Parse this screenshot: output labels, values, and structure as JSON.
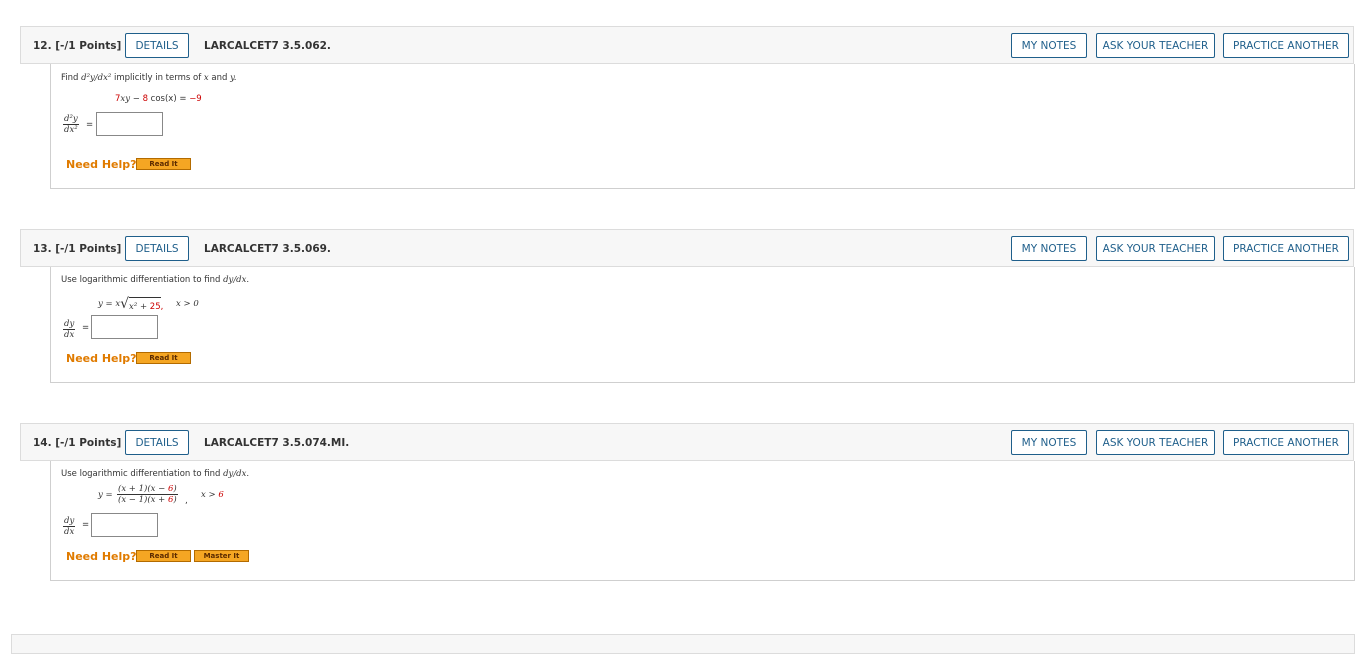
{
  "buttons": {
    "details": "DETAILS",
    "my_notes": "MY NOTES",
    "ask_teacher": "ASK YOUR TEACHER",
    "practice_another": "PRACTICE ANOTHER"
  },
  "need_help": "Need Help?",
  "help_buttons": {
    "read_it": "Read It",
    "master_it": "Master It"
  },
  "questions": [
    {
      "number": "12.  [-/1 Points]",
      "code": "LARCALCET7 3.5.062.",
      "prompt_pre": "Find ",
      "prompt_math": "d²y/dx²",
      "prompt_post": " implicitly in terms of ",
      "prompt_x": "x",
      "prompt_and": " and ",
      "prompt_y": "y.",
      "equation": {
        "c1": "7",
        "t1": "xy",
        "minus": " − ",
        "c2": "8",
        "t2": " cos(x) = ",
        "rhs": "−9"
      },
      "answer_lhs_top": "d²y",
      "answer_lhs_bot": "dx²",
      "answer_value": ""
    },
    {
      "number": "13.  [-/1 Points]",
      "code": "LARCALCET7 3.5.069.",
      "prompt_pre": "Use logarithmic differentiation to find ",
      "prompt_math": "dy/dx.",
      "equation": {
        "lhs": "y = x",
        "rad_a": "x² + ",
        "rad_b": "25",
        "comma": ",",
        "cond": "x > 0"
      },
      "answer_lhs_top": "dy",
      "answer_lhs_bot": "dx",
      "answer_value": ""
    },
    {
      "number": "14.  [-/1 Points]",
      "code": "LARCALCET7 3.5.074.MI.",
      "prompt_pre": "Use logarithmic differentiation to find ",
      "prompt_math": "dy/dx.",
      "equation": {
        "lhs": "y =",
        "num_a": "(x + 1)(x − ",
        "num_b": "6",
        "num_c": ")",
        "den_a": "(x − 1)(x + ",
        "den_b": "6",
        "den_c": ")",
        "comma": ",",
        "cond_a": "x > ",
        "cond_b": "6"
      },
      "answer_lhs_top": "dy",
      "answer_lhs_bot": "dx",
      "answer_value": ""
    }
  ],
  "colors": {
    "accent_blue": "#1f5f8b",
    "highlight_red": "#cc0000",
    "help_orange": "#e07b00",
    "button_orange": "#f5a623"
  }
}
